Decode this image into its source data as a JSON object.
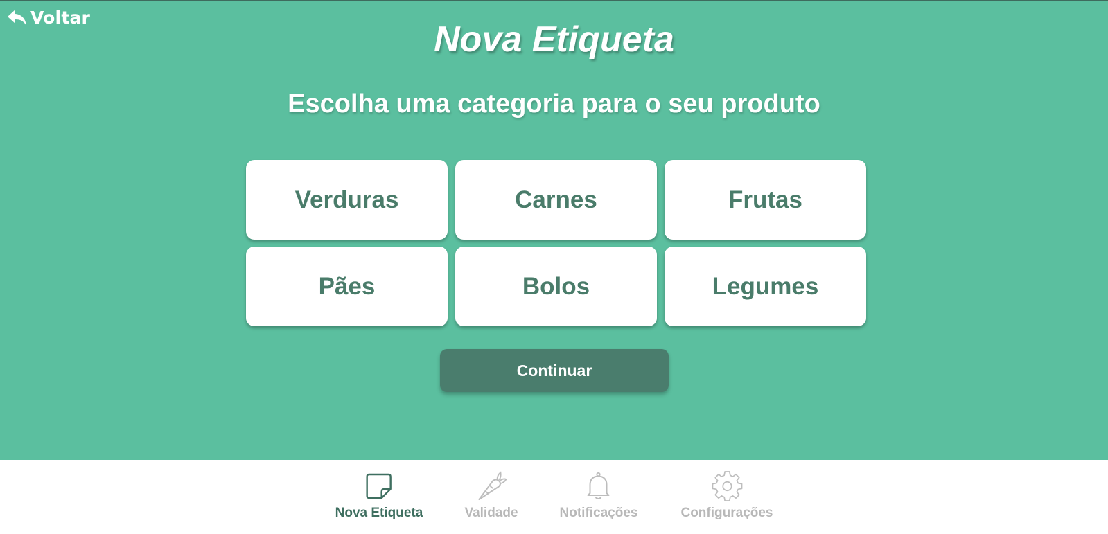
{
  "header": {
    "back_label": "Voltar",
    "title": "Nova Etiqueta",
    "subtitle": "Escolha uma categoria para o seu produto"
  },
  "categories": [
    {
      "label": "Verduras"
    },
    {
      "label": "Carnes"
    },
    {
      "label": "Frutas"
    },
    {
      "label": "Pães"
    },
    {
      "label": "Bolos"
    },
    {
      "label": "Legumes"
    }
  ],
  "actions": {
    "continue_label": "Continuar"
  },
  "bottom_nav": {
    "items": [
      {
        "label": "Nova Etiqueta",
        "icon": "note-icon",
        "active": true
      },
      {
        "label": "Validade",
        "icon": "carrot-icon",
        "active": false
      },
      {
        "label": "Notificações",
        "icon": "bell-icon",
        "active": false
      },
      {
        "label": "Configurações",
        "icon": "gear-icon",
        "active": false
      }
    ]
  },
  "colors": {
    "background": "#5bbf9f",
    "card": "#ffffff",
    "card_text": "#4a7c6a",
    "button": "#4a7d6d",
    "nav_active": "#3f6f60",
    "nav_inactive": "#b8b8b8"
  }
}
